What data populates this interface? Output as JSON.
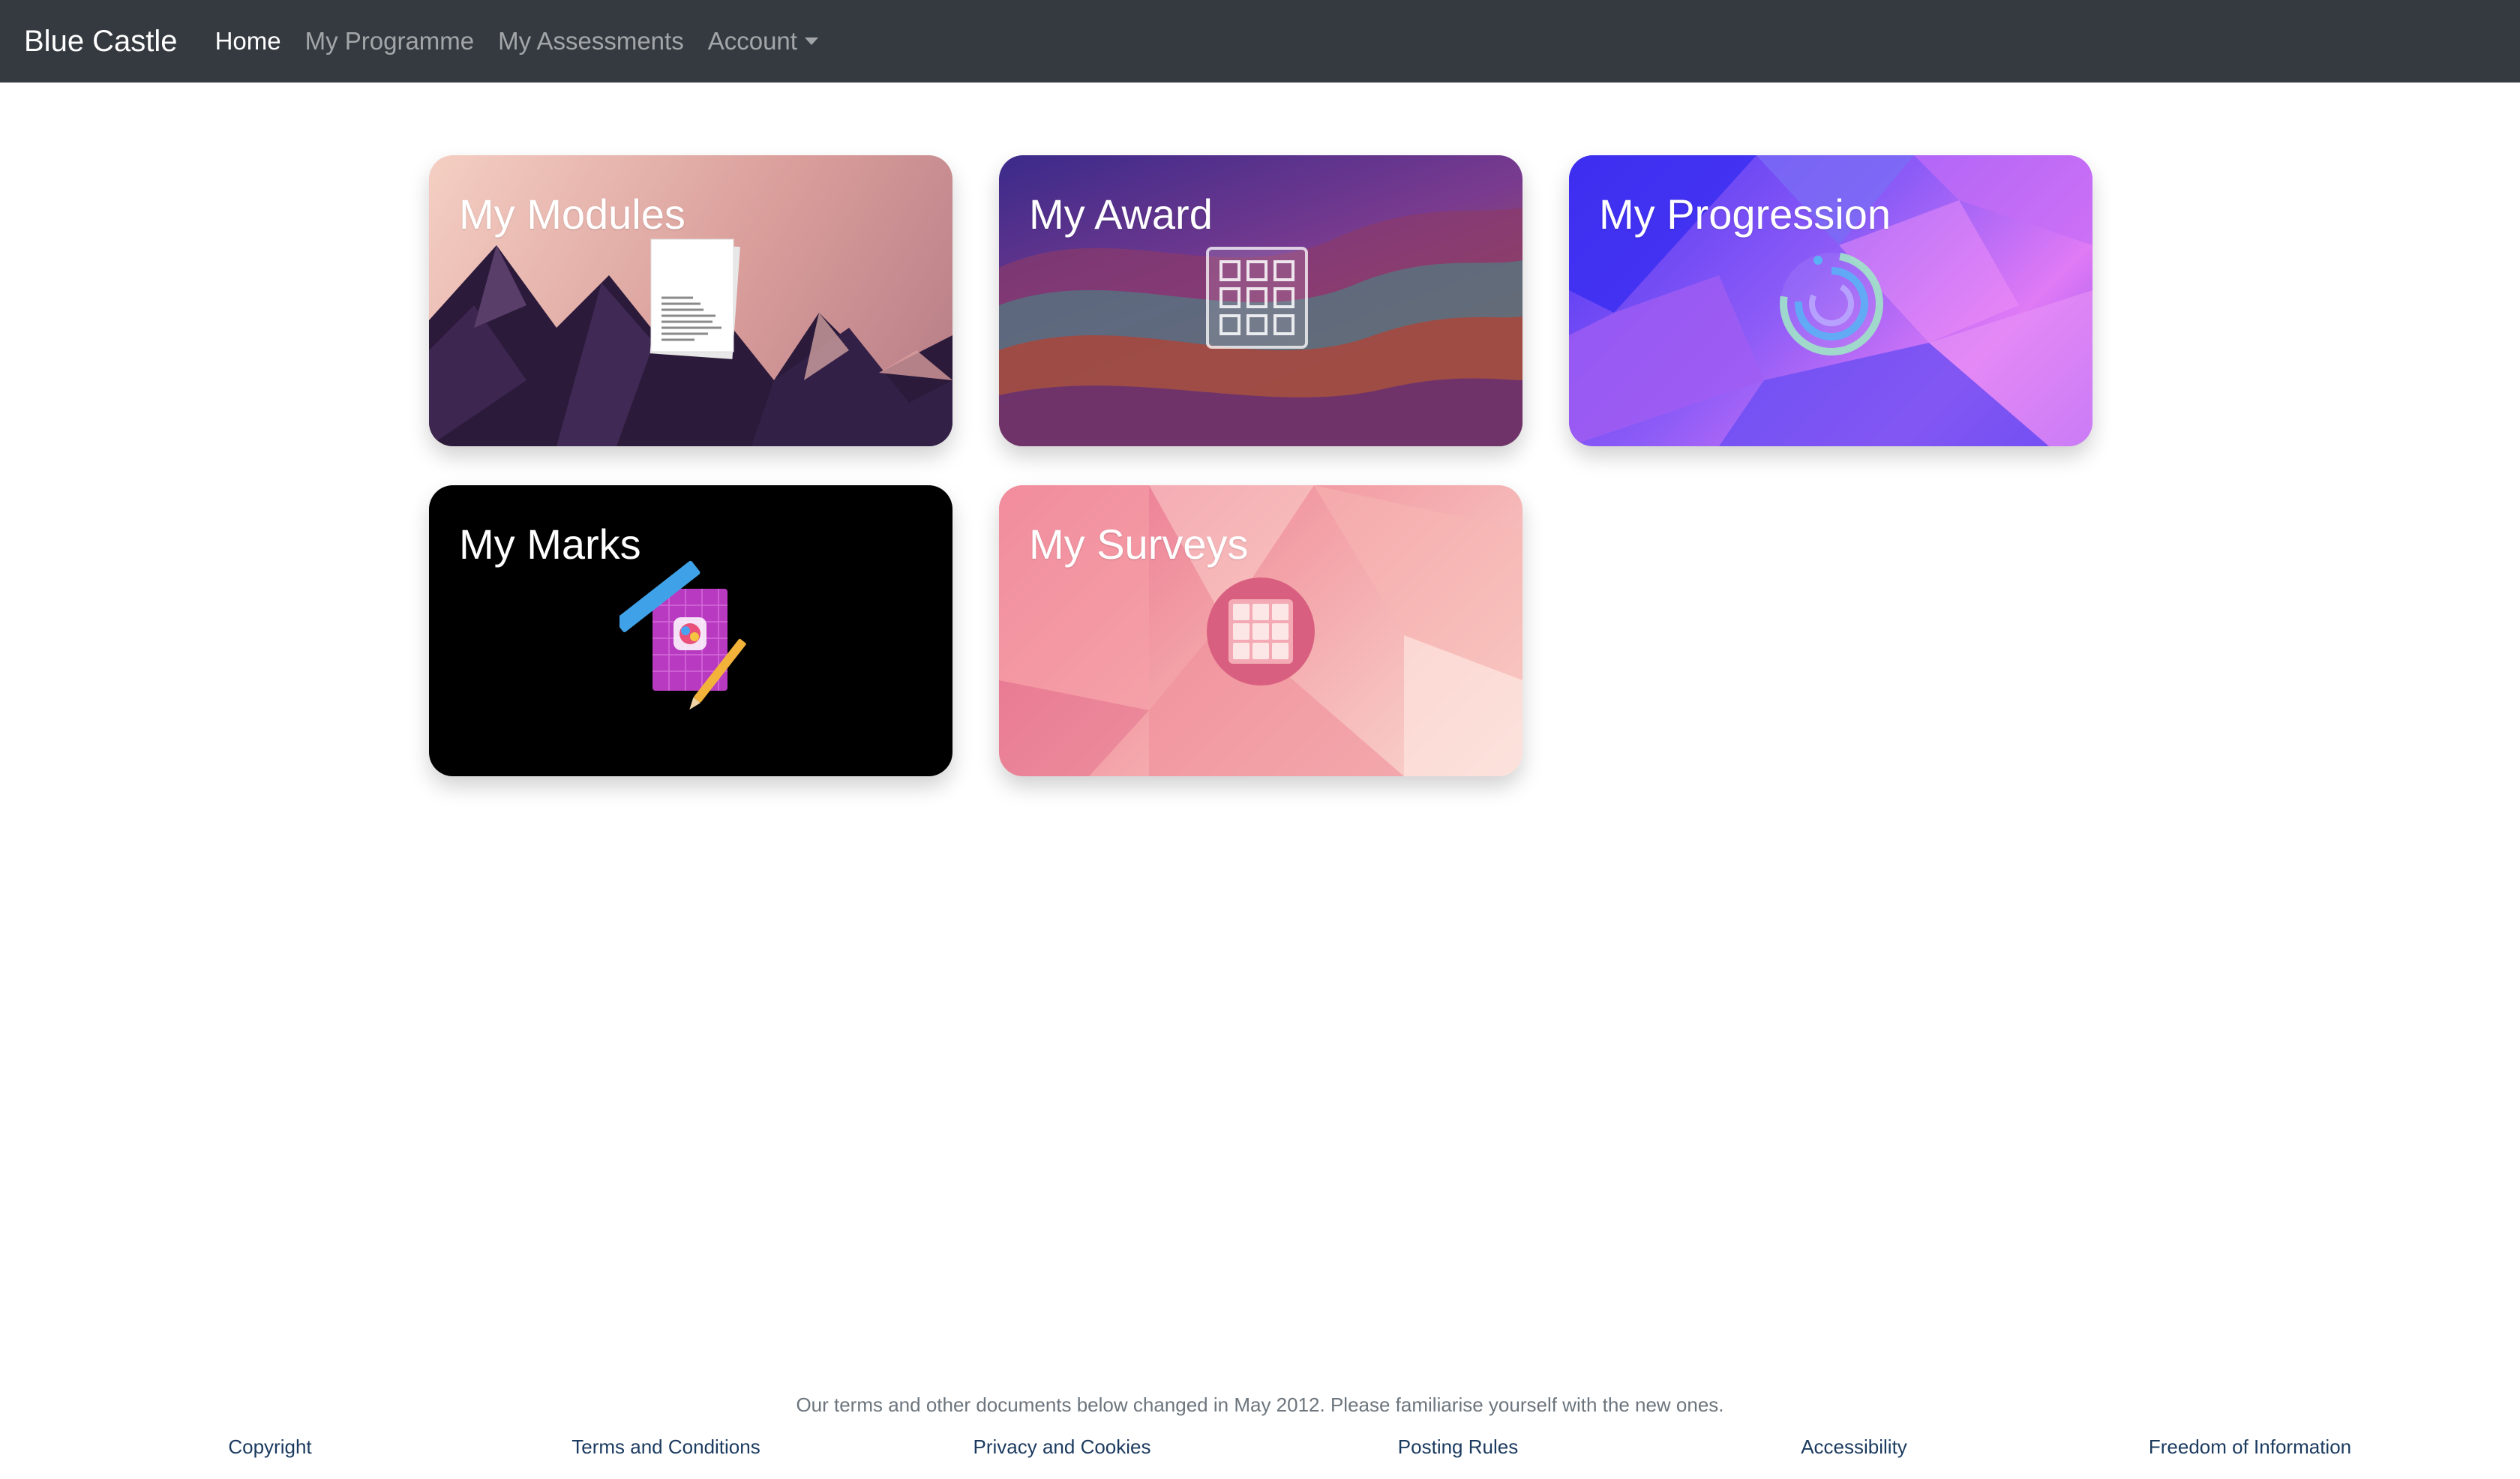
{
  "navbar": {
    "brand": "Blue Castle",
    "items": [
      {
        "label": "Home",
        "active": true
      },
      {
        "label": "My Programme",
        "active": false
      },
      {
        "label": "My Assessments",
        "active": false
      },
      {
        "label": "Account",
        "active": false,
        "dropdown": true
      }
    ]
  },
  "tiles": [
    {
      "title": "My Modules",
      "icon": "document-icon"
    },
    {
      "title": "My Award",
      "icon": "grid-icon"
    },
    {
      "title": "My Progression",
      "icon": "progress-ring-icon"
    },
    {
      "title": "My Marks",
      "icon": "notebook-ruler-pencil-icon"
    },
    {
      "title": "My Surveys",
      "icon": "table-icon"
    }
  ],
  "footer": {
    "note": "Our terms and other documents below changed in May 2012. Please familiarise yourself with the new ones.",
    "links": [
      "Copyright",
      "Terms and Conditions",
      "Privacy and Cookies",
      "Posting Rules",
      "Accessibility",
      "Freedom of Information"
    ]
  },
  "colors": {
    "navbar_bg": "#343a40",
    "nav_active": "#ffffff",
    "nav_inactive": "#9a9da0",
    "footer_link": "#1b3a5f",
    "footer_note": "#6c757d"
  }
}
